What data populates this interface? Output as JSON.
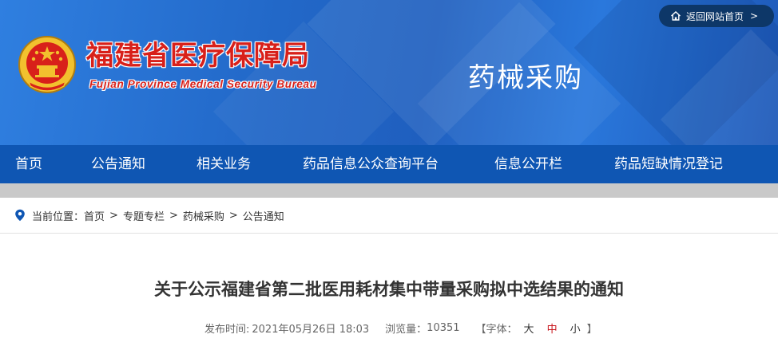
{
  "header": {
    "site_title": "福建省医疗保障局",
    "site_subtitle": "Fujian Province Medical Security Bureau",
    "section_title": "药械采购",
    "home_link": "返回网站首页",
    "home_link_chevron": ">"
  },
  "nav": {
    "items": [
      {
        "label": "首页"
      },
      {
        "label": "公告通知"
      },
      {
        "label": "相关业务"
      },
      {
        "label": "药品信息公众查询平台"
      },
      {
        "label": "信息公开栏"
      },
      {
        "label": "药品短缺情况登记"
      }
    ]
  },
  "breadcrumb": {
    "prefix": "当前位置：",
    "items": [
      "首页",
      "专题专栏",
      "药械采购",
      "公告通知"
    ],
    "separator": ">"
  },
  "article": {
    "title": "关于公示福建省第二批医用耗材集中带量采购拟中选结果的通知",
    "publish_label": "发布时间:",
    "publish_time": "2021年05月26日 18:03",
    "views_label": "浏览量：",
    "views": "10351",
    "font_open": "【字体：",
    "font_large": "大",
    "font_medium": "中",
    "font_small": "小",
    "font_close": "】"
  },
  "colors": {
    "nav_bg": "#0f56b3",
    "title_red": "#d8201a",
    "home_link_bg": "#0d3768"
  },
  "icons": {
    "home": "home-icon",
    "location": "location-pin-icon",
    "emblem": "national-emblem-icon"
  }
}
